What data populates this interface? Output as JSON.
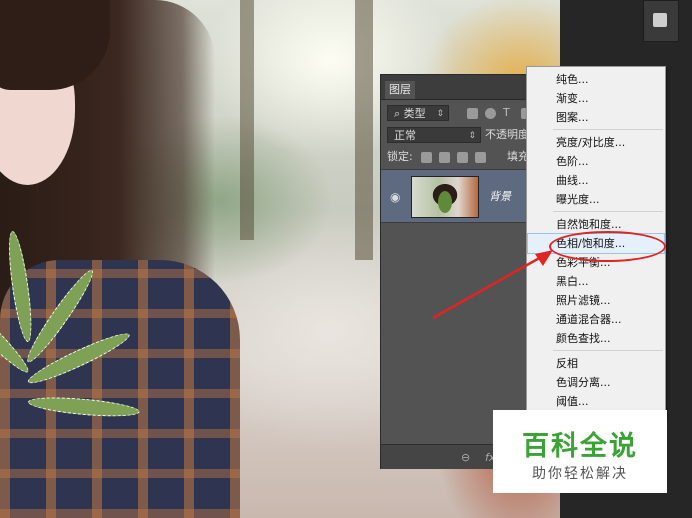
{
  "layers_panel": {
    "tab_label": "图层",
    "filter_type": "类型",
    "blend_mode": "正常",
    "opacity_label": "不透明度",
    "lock_label": "锁定:",
    "fill_label": "填充",
    "layer_name": "背景",
    "link_glyph": "⊖",
    "fx_glyph": "fx"
  },
  "adjustment_menu": {
    "items": [
      {
        "label": "纯色..."
      },
      {
        "label": "渐变..."
      },
      {
        "label": "图案..."
      },
      {
        "label": "亮度/对比度..."
      },
      {
        "label": "色阶..."
      },
      {
        "label": "曲线..."
      },
      {
        "label": "曝光度..."
      },
      {
        "label": "自然饱和度..."
      },
      {
        "label": "色相/饱和度..."
      },
      {
        "label": "色彩平衡..."
      },
      {
        "label": "黑白..."
      },
      {
        "label": "照片滤镜..."
      },
      {
        "label": "通道混合器..."
      },
      {
        "label": "颜色查找..."
      },
      {
        "label": "反相"
      },
      {
        "label": "色调分离..."
      },
      {
        "label": "阈值..."
      }
    ],
    "highlighted": "色相/饱和度..."
  },
  "watermark": {
    "title": "百科全说",
    "subtitle": "助你轻松解决"
  },
  "colors": {
    "annotation": "#e02424",
    "watermark_green": "#3aa335",
    "panel_bg": "#535353",
    "selected_layer": "#5d6a80"
  }
}
